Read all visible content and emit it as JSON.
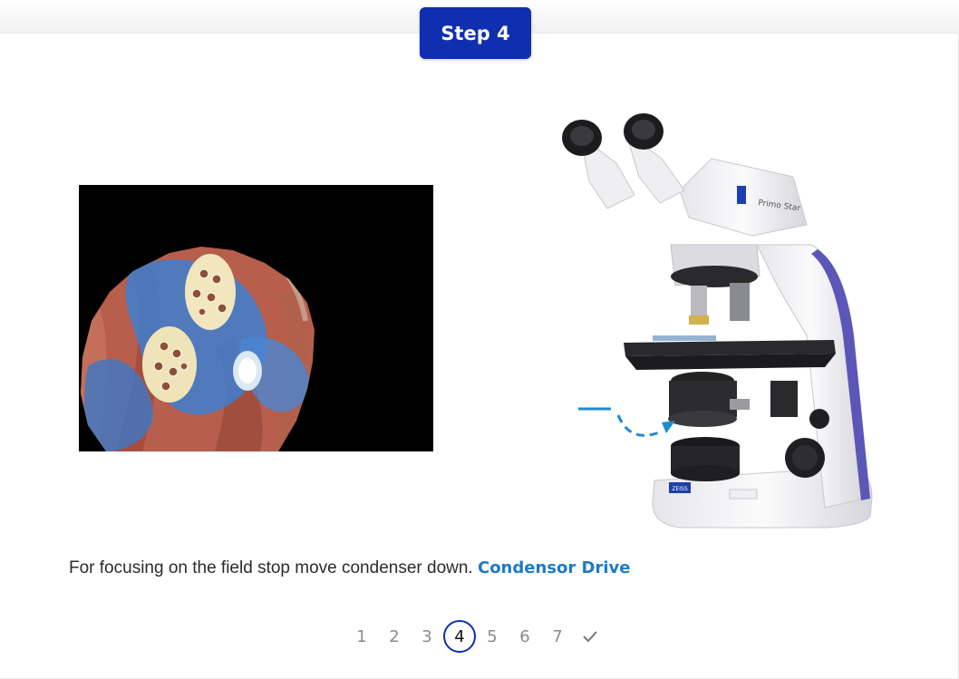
{
  "header": {
    "step_label": "Step 4"
  },
  "instruction": {
    "text": "For focusing on the field stop move condenser down.",
    "link_label": "Condensor Drive"
  },
  "microscope": {
    "brand_logo": "ZEISS",
    "model": "Primo Star"
  },
  "pagination": {
    "pages": [
      "1",
      "2",
      "3",
      "4",
      "5",
      "6",
      "7"
    ],
    "current": "4",
    "done_icon": "check-icon"
  },
  "colors": {
    "accent": "#0f2fb0",
    "link": "#1f7ac4",
    "arrow": "#1f8ad0"
  }
}
